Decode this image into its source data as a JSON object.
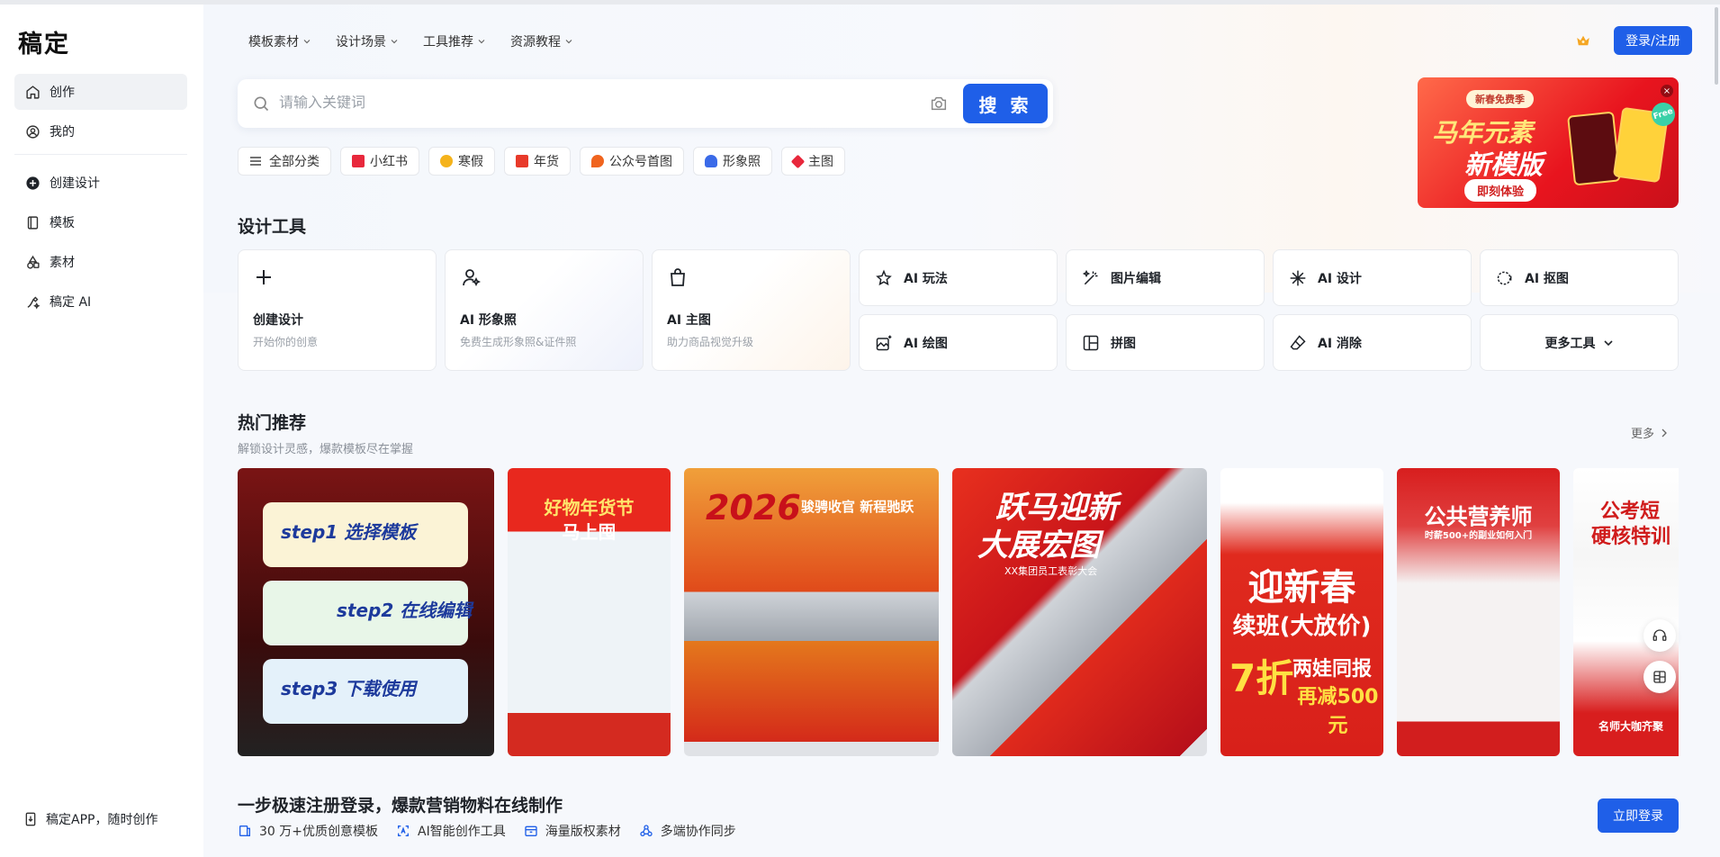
{
  "brand": {
    "logo": "稿定"
  },
  "sidebar": {
    "items": [
      {
        "label": "创作"
      },
      {
        "label": "我的"
      },
      {
        "label": "创建设计"
      },
      {
        "label": "模板"
      },
      {
        "label": "素材"
      },
      {
        "label": "稿定 AI"
      }
    ],
    "app_link": "稿定APP，随时创作"
  },
  "topnav": {
    "items": [
      "模板素材",
      "设计场景",
      "工具推荐",
      "资源教程"
    ],
    "login": "登录/注册"
  },
  "search": {
    "placeholder": "请输入关键词",
    "button": "搜 索"
  },
  "chips": [
    {
      "label": "全部分类",
      "color": "#555555"
    },
    {
      "label": "小红书",
      "color": "#e8283c"
    },
    {
      "label": "寒假",
      "color": "#f5b31b"
    },
    {
      "label": "年货",
      "color": "#e83a2a"
    },
    {
      "label": "公众号首图",
      "color": "#f0641e"
    },
    {
      "label": "形象照",
      "color": "#3a6ae8"
    },
    {
      "label": "主图",
      "color": "#e8283c"
    }
  ],
  "banner": {
    "tag": "新春免费季",
    "title1": "马年元素",
    "title2": "新模版",
    "cta": "即刻体验",
    "badge": "Free",
    "close": "×"
  },
  "tools": {
    "title": "设计工具",
    "big": [
      {
        "title": "创建设计",
        "desc": "开始你的创意"
      },
      {
        "title": "AI 形象照",
        "desc": "免费生成形象照&证件照"
      },
      {
        "title": "AI 主图",
        "desc": "助力商品视觉升级"
      }
    ],
    "small": [
      {
        "label": "AI 玩法"
      },
      {
        "label": "图片编辑"
      },
      {
        "label": "AI 设计"
      },
      {
        "label": "AI 抠图"
      },
      {
        "label": "AI 绘图"
      },
      {
        "label": "拼图"
      },
      {
        "label": "AI 消除"
      },
      {
        "label": "更多工具"
      }
    ]
  },
  "hot": {
    "title": "热门推荐",
    "subtitle": "解锁设计灵感，爆款模板尽在掌握",
    "more": "更多",
    "cards": [
      {
        "lines": [
          "step1 选择模板",
          "step2 在线编辑",
          "step3 下载使用"
        ]
      },
      {
        "lines": [
          "好物年货节",
          "马上囤"
        ]
      },
      {
        "lines": [
          "2026",
          "骏骋收官 新程驰跃"
        ]
      },
      {
        "lines": [
          "跃马迎新",
          "大展宏图",
          "XX集团员工表彰大会"
        ]
      },
      {
        "lines": [
          "迎新春",
          "续班(大放价)",
          "7折",
          "两娃同报",
          "再减500元"
        ]
      },
      {
        "lines": [
          "公共营养师",
          "时薪500+的副业如何入门"
        ]
      },
      {
        "lines": [
          "公考短",
          "硬核特训",
          "名师大咖齐聚"
        ]
      }
    ]
  },
  "footer": {
    "title": "一步极速注册登录，爆款营销物料在线制作",
    "features": [
      "30 万+优质创意模板",
      "AI智能创作工具",
      "海量版权素材",
      "多端协作同步"
    ],
    "cta": "立即登录"
  }
}
